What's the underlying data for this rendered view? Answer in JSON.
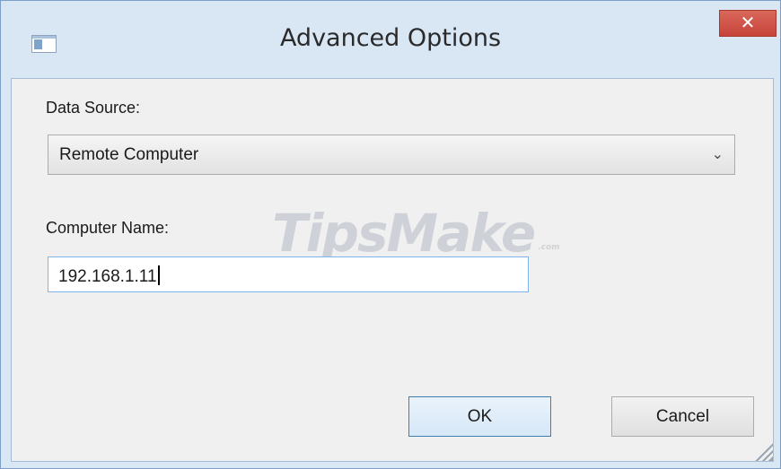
{
  "window": {
    "title": "Advanced Options",
    "app_icon": "window-icon",
    "close_label": "✕"
  },
  "form": {
    "data_source_label": "Data Source:",
    "data_source_value": "Remote Computer",
    "data_source_chevron": "⌄",
    "computer_name_label": "Computer Name:",
    "computer_name_value": "192.168.1.11"
  },
  "buttons": {
    "ok_label": "OK",
    "cancel_label": "Cancel"
  },
  "watermark": {
    "text": "TipsMake",
    "suffix": ".com"
  },
  "colors": {
    "frame": "#d9e6f4",
    "close_button": "#c7433a",
    "focus_border": "#7eb4ea",
    "default_button_border": "#3c7fb1"
  }
}
